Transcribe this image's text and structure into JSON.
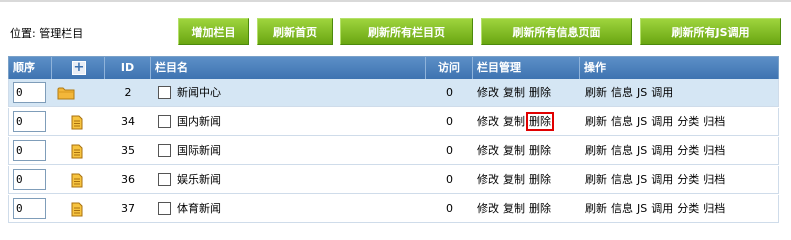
{
  "location": "位置: 管理栏目",
  "toolbar": {
    "add": "增加栏目",
    "refresh_home": "刷新首页",
    "refresh_all_columns": "刷新所有栏目页",
    "refresh_all_info": "刷新所有信息页面",
    "refresh_all_js": "刷新所有JS调用"
  },
  "headers": {
    "order": "顺序",
    "plus": "+",
    "id": "ID",
    "name": "栏目名",
    "visits": "访问",
    "manage": "栏目管理",
    "ops": "操作"
  },
  "rows": [
    {
      "order": "0",
      "icon": "folder-icon",
      "id": "2",
      "name": "新闻中心",
      "visits": "0",
      "manage": [
        "修改",
        "复制",
        "删除"
      ],
      "ops": [
        "刷新",
        "信息",
        "JS",
        "调用"
      ]
    },
    {
      "order": "0",
      "icon": "document-icon",
      "id": "34",
      "name": "国内新闻",
      "visits": "0",
      "manage": [
        "修改",
        "复制",
        "删除"
      ],
      "ops": [
        "刷新",
        "信息",
        "JS",
        "调用",
        "分类",
        "归档"
      ]
    },
    {
      "order": "0",
      "icon": "document-icon",
      "id": "35",
      "name": "国际新闻",
      "visits": "0",
      "manage": [
        "修改",
        "复制",
        "删除"
      ],
      "ops": [
        "刷新",
        "信息",
        "JS",
        "调用",
        "分类",
        "归档"
      ]
    },
    {
      "order": "0",
      "icon": "document-icon",
      "id": "36",
      "name": "娱乐新闻",
      "visits": "0",
      "manage": [
        "修改",
        "复制",
        "删除"
      ],
      "ops": [
        "刷新",
        "信息",
        "JS",
        "调用",
        "分类",
        "归档"
      ]
    },
    {
      "order": "0",
      "icon": "document-icon",
      "id": "37",
      "name": "体育新闻",
      "visits": "0",
      "manage": [
        "修改",
        "复制",
        "删除"
      ],
      "ops": [
        "刷新",
        "信息",
        "JS",
        "调用",
        "分类",
        "归档"
      ]
    }
  ],
  "colors": {
    "button_green": "#7ab51f",
    "header_blue": "#4a80bd",
    "first_row_bg": "#d5e6f4",
    "highlight_red": "#e00000"
  }
}
